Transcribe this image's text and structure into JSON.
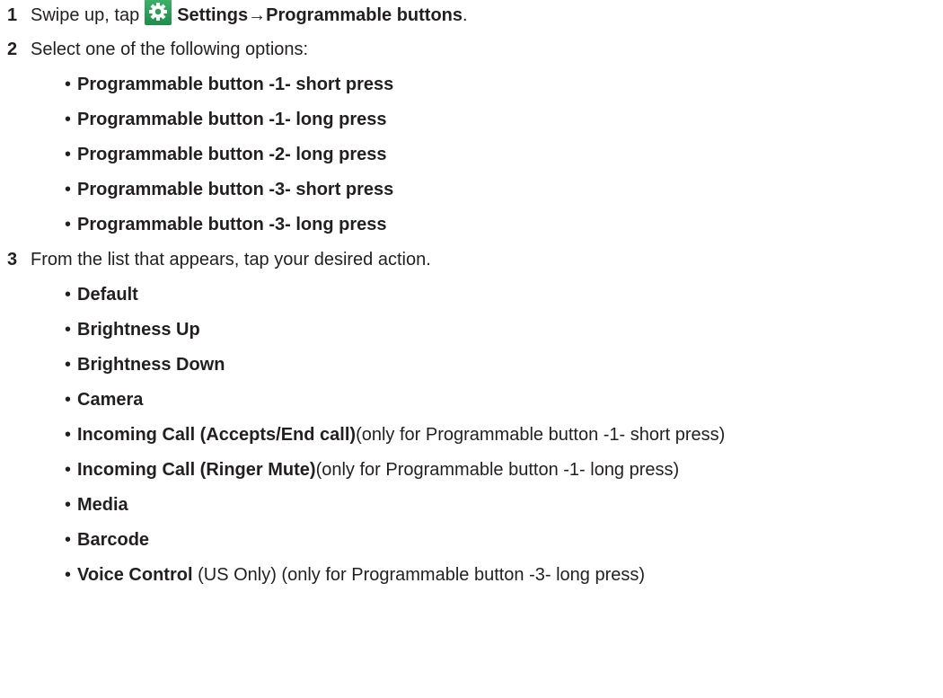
{
  "steps": [
    {
      "num": "1",
      "pre": "Swipe up, tap",
      "icon": "settings-gear-icon",
      "bold": "Settings→Programmable buttons",
      "post": "."
    },
    {
      "num": "2",
      "text": "Select one of the following options:"
    },
    {
      "num": "3",
      "text": "From the list that appears, tap your desired action."
    }
  ],
  "options": [
    "Programmable button -1- short press",
    "Programmable button -1- long press",
    "Programmable button -2- long press",
    "Programmable button -3- short press",
    "Programmable button -3- long press"
  ],
  "actions": [
    {
      "bold": "Default",
      "note": ""
    },
    {
      "bold": "Brightness Up",
      "note": ""
    },
    {
      "bold": "Brightness Down",
      "note": ""
    },
    {
      "bold": "Camera",
      "note": ""
    },
    {
      "bold": "Incoming Call (Accepts/End call)",
      "note": "(only for Programmable button -1- short press)"
    },
    {
      "bold": "Incoming Call (Ringer Mute)",
      "note": "(only for Programmable button -1- long press)"
    },
    {
      "bold": "Media",
      "note": ""
    },
    {
      "bold": "Barcode",
      "note": ""
    },
    {
      "bold": "Voice Control",
      "note": " (US Only) (only for Programmable button -3- long press)"
    }
  ],
  "bullet_char": "•",
  "colors": {
    "text": "#231f20",
    "icon_green": "#2aa15a"
  }
}
